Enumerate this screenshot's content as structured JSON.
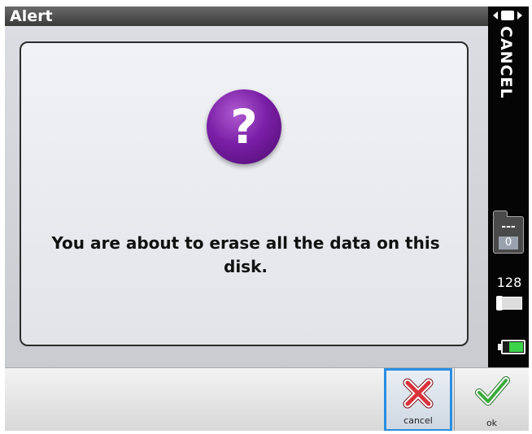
{
  "window": {
    "title": "Alert"
  },
  "dialog": {
    "icon": "question-mark-icon",
    "icon_glyph": "?",
    "message": "You are about to erase all the data on this disk."
  },
  "sidebar": {
    "cancel_label": "CANCEL",
    "folder_dashes": "---",
    "folder_count": "0",
    "memory_value": "128",
    "battery_color": "#3bd34a"
  },
  "buttons": {
    "cancel_label": "cancel",
    "ok_label": "ok"
  },
  "colors": {
    "accent_border": "#2a8de0",
    "question_icon": "#7a1fa6",
    "cancel_x": "#d9323a",
    "ok_check": "#3aaa3a"
  }
}
